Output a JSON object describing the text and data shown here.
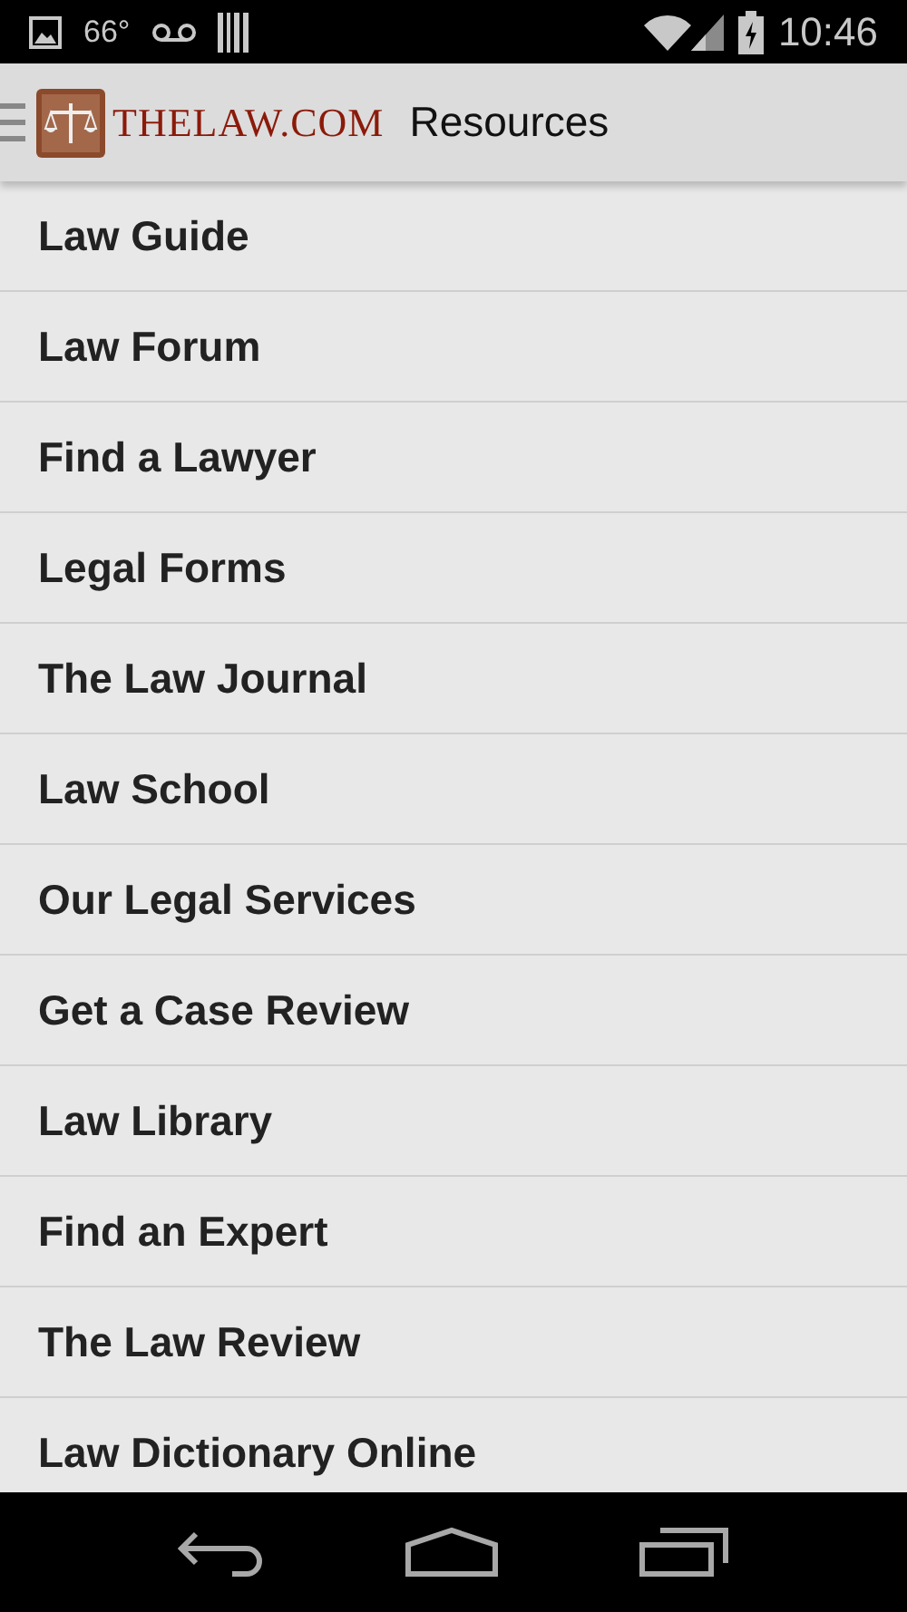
{
  "status_bar": {
    "temperature": "66°",
    "time": "10:46"
  },
  "app_bar": {
    "logo_text": "THELAW.COM",
    "title": "Resources"
  },
  "items": [
    {
      "label": "Law Guide"
    },
    {
      "label": "Law Forum"
    },
    {
      "label": "Find a Lawyer"
    },
    {
      "label": "Legal Forms"
    },
    {
      "label": "The Law Journal"
    },
    {
      "label": "Law School"
    },
    {
      "label": "Our Legal Services"
    },
    {
      "label": "Get a Case Review"
    },
    {
      "label": "Law Library"
    },
    {
      "label": "Find an Expert"
    },
    {
      "label": "The Law Review"
    },
    {
      "label": "Law Dictionary Online"
    }
  ]
}
